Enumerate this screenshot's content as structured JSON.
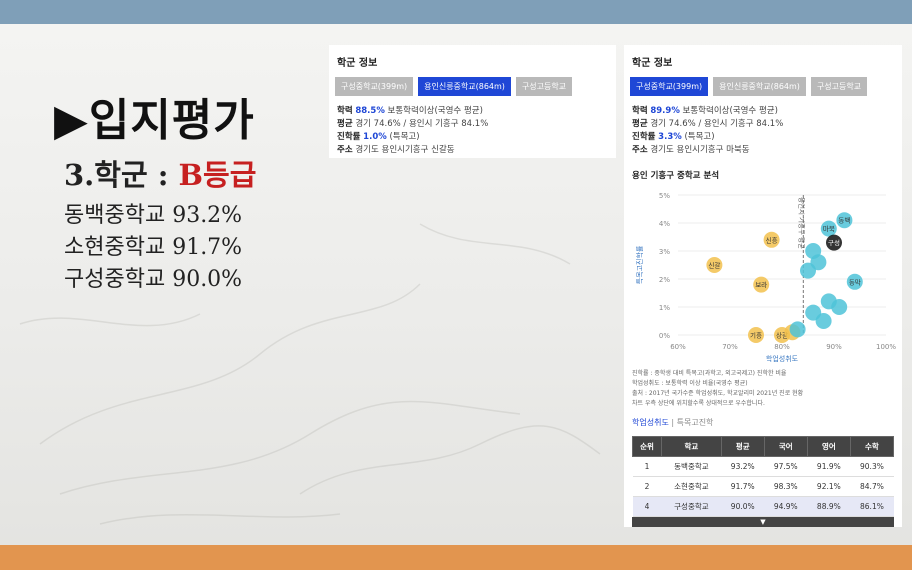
{
  "slide": {
    "heading": "▶입지평가",
    "subheading_prefix": "3.학군 : ",
    "grade": "B등급",
    "schools": [
      "동백중학교 93.2%",
      "소현중학교 91.7%",
      "구성중학교 90.0%"
    ]
  },
  "card_left": {
    "title": "학군 정보",
    "tabs": [
      "구성중학교(399m)",
      "용인신릉중학교(864m)",
      "구성고등학교"
    ],
    "active_tab": 1,
    "rows": [
      {
        "label": "학력",
        "value": "88.5%",
        "rest": " 보통학력이상(국영수 평균)"
      },
      {
        "label": "평균",
        "value": "",
        "rest": " 경기 74.6% / 용인시 기흥구 84.1%"
      },
      {
        "label": "진학률",
        "value": "1.0%",
        "rest": " (특목고)"
      },
      {
        "label": "주소",
        "value": "",
        "rest": " 경기도 용인시기흥구 신갈동"
      }
    ]
  },
  "card_right": {
    "title": "학군 정보",
    "tabs": [
      "구성중학교(399m)",
      "용인신릉중학교(864m)",
      "구성고등학교"
    ],
    "active_tab": 0,
    "rows": [
      {
        "label": "학력",
        "value": "89.9%",
        "rest": " 보통학력이상(국영수 평균)"
      },
      {
        "label": "평균",
        "value": "",
        "rest": " 경기 74.6% / 용인시 기흥구 84.1%"
      },
      {
        "label": "진학률",
        "value": "3.3%",
        "rest": " (특목고)"
      },
      {
        "label": "주소",
        "value": "",
        "rest": " 경기도 용인시기흥구 마북동"
      }
    ],
    "analysis_title": "용인 기흥구 중학교 분석",
    "notes": [
      "진학률 : 중학생 대비 특목고(과학고, 외고국제고) 진학한 비율",
      "학업성취도 : 보통학력 이상 비율(국영수 평균)",
      "출처 : 2017년 국가수준 학업성취도, 학교알리미 2021년 진로 현황",
      "차트 우측 상단에 위치할수록 상대적으로 우수합니다."
    ],
    "subtabs": [
      "학업성취도",
      "특목고진학"
    ],
    "table": {
      "headers": [
        "순위",
        "학교",
        "평균",
        "국어",
        "영어",
        "수학"
      ],
      "rows": [
        [
          "1",
          "동백중학교",
          "93.2%",
          "97.5%",
          "91.9%",
          "90.3%"
        ],
        [
          "2",
          "소현중학교",
          "91.7%",
          "98.3%",
          "92.1%",
          "84.7%"
        ],
        [
          "4",
          "구성중학교",
          "90.0%",
          "94.9%",
          "88.9%",
          "86.1%"
        ]
      ],
      "selected_row": 2
    },
    "more_icon": "caret-down-icon"
  },
  "chart_data": {
    "type": "scatter",
    "x_ticks": [
      "60%",
      "70%",
      "80%",
      "90%",
      "100%"
    ],
    "y_ticks": [
      "0%",
      "1%",
      "2%",
      "3%",
      "4%",
      "5%"
    ],
    "xlim": [
      60,
      100
    ],
    "ylim": [
      0,
      5
    ],
    "xlabel": "학업성취도",
    "ylabel": "특목고진학률",
    "ref_line_label": "용인시 기흥구 평균",
    "ref_x": 84.1,
    "points": [
      {
        "label": "신갈",
        "x": 67,
        "y": 2.5,
        "color": "#f2c14e"
      },
      {
        "label": "신흥",
        "x": 78,
        "y": 3.4,
        "color": "#f2c14e"
      },
      {
        "label": "보라",
        "x": 76,
        "y": 1.8,
        "color": "#f2c14e"
      },
      {
        "label": "기흥",
        "x": 75,
        "y": 0.0,
        "color": "#f2c14e"
      },
      {
        "label": "상갈",
        "x": 80,
        "y": 0.0,
        "color": "#f2c14e"
      },
      {
        "label": "",
        "x": 82,
        "y": 0.1,
        "color": "#f2c14e"
      },
      {
        "label": "마북",
        "x": 89,
        "y": 3.8,
        "color": "#4fc3d8"
      },
      {
        "label": "동백",
        "x": 92,
        "y": 4.1,
        "color": "#4fc3d8"
      },
      {
        "label": "구성",
        "x": 90,
        "y": 3.3,
        "color": "#111111"
      },
      {
        "label": "",
        "x": 86,
        "y": 3.0,
        "color": "#4fc3d8"
      },
      {
        "label": "",
        "x": 87,
        "y": 2.6,
        "color": "#4fc3d8"
      },
      {
        "label": "",
        "x": 85,
        "y": 2.3,
        "color": "#4fc3d8"
      },
      {
        "label": "동막",
        "x": 94,
        "y": 1.9,
        "color": "#4fc3d8"
      },
      {
        "label": "",
        "x": 89,
        "y": 1.2,
        "color": "#4fc3d8"
      },
      {
        "label": "",
        "x": 91,
        "y": 1.0,
        "color": "#4fc3d8"
      },
      {
        "label": "",
        "x": 86,
        "y": 0.8,
        "color": "#4fc3d8"
      },
      {
        "label": "",
        "x": 88,
        "y": 0.5,
        "color": "#4fc3d8"
      },
      {
        "label": "",
        "x": 83,
        "y": 0.2,
        "color": "#4fc3d8"
      }
    ]
  },
  "colors": {
    "accent": "#1f47d6",
    "grade_red": "#c62020",
    "top_bar": "#7f9fb8",
    "bottom_bar": "#e2954f"
  }
}
